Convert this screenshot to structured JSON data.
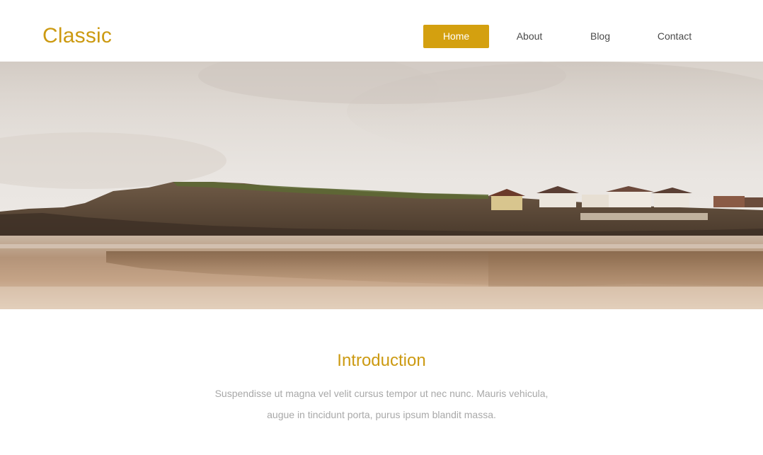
{
  "brand": {
    "name": "Classic",
    "accent_color": "#d4a00f"
  },
  "nav": {
    "items": [
      {
        "label": "Home",
        "active": true
      },
      {
        "label": "About",
        "active": false
      },
      {
        "label": "Blog",
        "active": false
      },
      {
        "label": "Contact",
        "active": false
      }
    ]
  },
  "hero": {
    "description": ""
  },
  "intro": {
    "title": "Introduction",
    "lines": [
      "Suspendisse ut magna vel velit cursus tempor ut nec nunc. Mauris vehicula,",
      "augue in tincidunt porta, purus ipsum blandit massa."
    ]
  }
}
